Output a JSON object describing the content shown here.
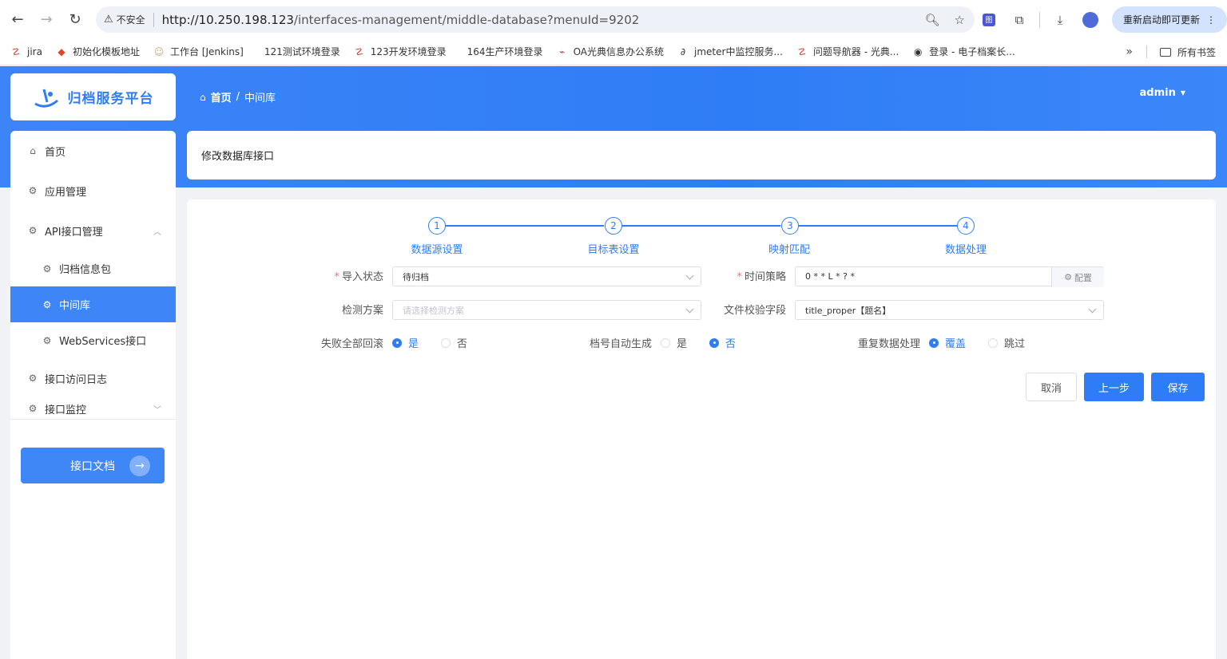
{
  "browser": {
    "security_label": "不安全",
    "url_host": "http://10.250.198.123",
    "url_path": "/interfaces-management/middle-database?menuId=9202",
    "update_label": "重新启动即可更新",
    "ext_badge": "图"
  },
  "bookmarks": {
    "items": [
      {
        "label": "jira",
        "icon": "jira-icon"
      },
      {
        "label": "初始化模板地址",
        "icon": "gitlab-icon"
      },
      {
        "label": "工作台 [Jenkins]",
        "icon": "jenkins-icon"
      },
      {
        "label": "121测试环境登录",
        "icon": ""
      },
      {
        "label": "123开发环境登录",
        "icon": "jira-icon"
      },
      {
        "label": "164生产环境登录",
        "icon": ""
      },
      {
        "label": "OA光典信息办公系统",
        "icon": "oa-icon"
      },
      {
        "label": "jmeter中监控服务...",
        "icon": "jmeter-icon"
      },
      {
        "label": "问题导航器 - 光典...",
        "icon": "jira-icon"
      },
      {
        "label": "登录 - 电子档案长...",
        "icon": "globe-icon"
      }
    ],
    "all_label": "所有书签"
  },
  "header": {
    "logo_text": "归档服务平台",
    "breadcrumb_home": "首页",
    "breadcrumb_sep": "/",
    "breadcrumb_current": "中间库",
    "user": "admin"
  },
  "sidebar": {
    "items": [
      {
        "label": "首页",
        "icon": "home-icon"
      },
      {
        "label": "应用管理",
        "icon": "gear-icon"
      },
      {
        "label": "API接口管理",
        "icon": "gear-icon"
      },
      {
        "label": "归档信息包",
        "icon": "gear-icon"
      },
      {
        "label": "中间库",
        "icon": "gear-icon"
      },
      {
        "label": "WebServices接口",
        "icon": "gear-icon"
      },
      {
        "label": "接口访问日志",
        "icon": "gear-icon"
      },
      {
        "label": "接口监控",
        "icon": "gear-icon"
      }
    ],
    "doc_button": "接口文档"
  },
  "page": {
    "title": "修改数据库接口"
  },
  "steps": [
    {
      "num": "1",
      "label": "数据源设置"
    },
    {
      "num": "2",
      "label": "目标表设置"
    },
    {
      "num": "3",
      "label": "映射匹配"
    },
    {
      "num": "4",
      "label": "数据处理"
    }
  ],
  "form": {
    "import_status_label": "导入状态",
    "import_status_value": "待归档",
    "time_strategy_label": "时间策略",
    "time_strategy_value": "0 * * L * ? *",
    "config_label": "配置",
    "check_scheme_label": "检测方案",
    "check_scheme_placeholder": "请选择检测方案",
    "file_check_label": "文件校验字段",
    "file_check_value": "title_proper【题名】",
    "rollback_label": "失败全部回滚",
    "rollback_yes": "是",
    "rollback_no": "否",
    "archno_label": "档号自动生成",
    "archno_yes": "是",
    "archno_no": "否",
    "dup_label": "重复数据处理",
    "dup_overwrite": "覆盖",
    "dup_skip": "跳过"
  },
  "actions": {
    "cancel": "取消",
    "prev": "上一步",
    "save": "保存"
  }
}
